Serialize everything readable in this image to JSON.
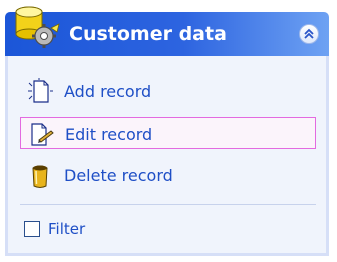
{
  "panel": {
    "title": "Customer data",
    "header_icon": "database-gear-icon",
    "collapse_icon": "double-chevron-up-icon"
  },
  "tasks": [
    {
      "label": "Add record",
      "icon": "new-document-icon"
    },
    {
      "label": "Edit record",
      "icon": "edit-document-icon",
      "selected": true
    },
    {
      "label": "Delete record",
      "icon": "trash-bin-icon"
    }
  ],
  "filter": {
    "label": "Filter",
    "checked": false
  },
  "colors": {
    "header_start": "#1b56d8",
    "header_end": "#6ea2f3",
    "link_text": "#1f4fc6",
    "selection_border": "#e36ae0",
    "body_bg": "#f0f4fc"
  }
}
